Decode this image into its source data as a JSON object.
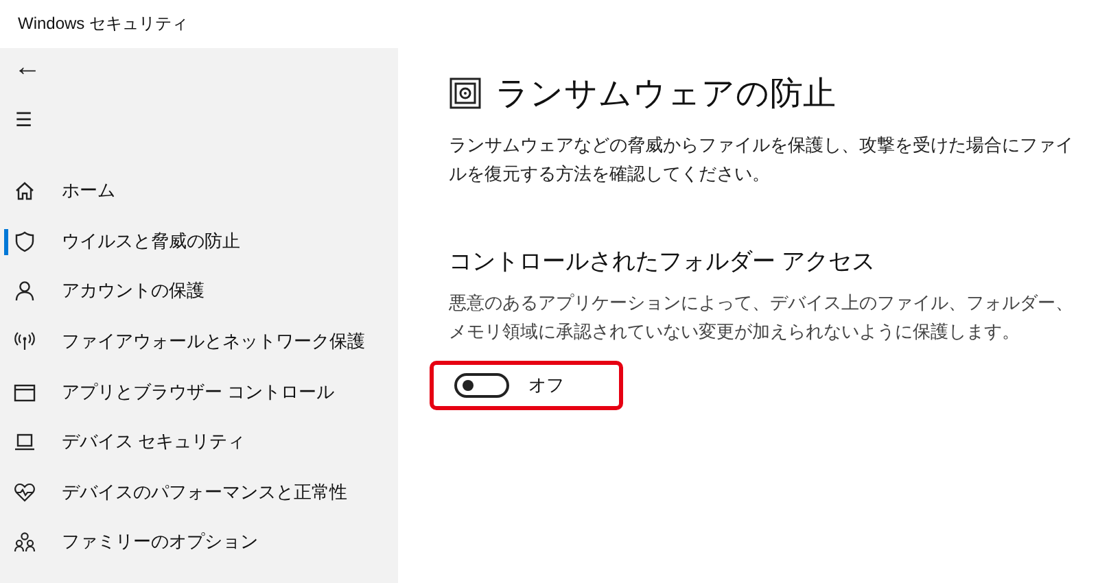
{
  "window": {
    "title": "Windows セキュリティ"
  },
  "sidebar": {
    "back": "←",
    "menu": "☰",
    "items": [
      {
        "label": "ホーム",
        "selected": false
      },
      {
        "label": "ウイルスと脅威の防止",
        "selected": true
      },
      {
        "label": "アカウントの保護",
        "selected": false
      },
      {
        "label": "ファイアウォールとネットワーク保護",
        "selected": false
      },
      {
        "label": "アプリとブラウザー コントロール",
        "selected": false
      },
      {
        "label": "デバイス セキュリティ",
        "selected": false
      },
      {
        "label": "デバイスのパフォーマンスと正常性",
        "selected": false
      },
      {
        "label": "ファミリーのオプション",
        "selected": false
      }
    ]
  },
  "page": {
    "title": "ランサムウェアの防止",
    "description": "ランサムウェアなどの脅威からファイルを保護し、攻撃を受けた場合にファイルを復元する方法を確認してください。",
    "section": {
      "title": "コントロールされたフォルダー アクセス",
      "description": "悪意のあるアプリケーションによって、デバイス上のファイル、フォルダー、メモリ領域に承認されていない変更が加えられないように保護します。",
      "toggle": {
        "on": false,
        "label": "オフ",
        "highlighted": true
      }
    }
  }
}
